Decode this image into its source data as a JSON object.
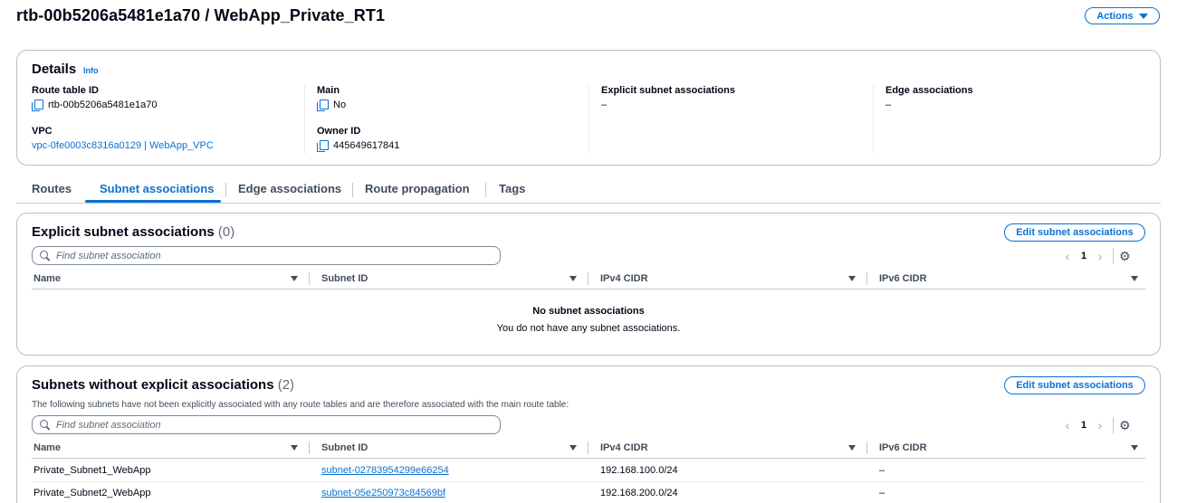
{
  "header": {
    "title": "rtb-00b5206a5481e1a70 / WebApp_Private_RT1",
    "actions_label": "Actions"
  },
  "details": {
    "heading": "Details",
    "info_label": "Info",
    "route_table_id_label": "Route table ID",
    "route_table_id": "rtb-00b5206a5481e1a70",
    "vpc_label": "VPC",
    "vpc_value": "vpc-0fe0003c8316a0129 | WebApp_VPC",
    "main_label": "Main",
    "main_value": "No",
    "owner_id_label": "Owner ID",
    "owner_id": "445649617841",
    "explicit_label": "Explicit subnet associations",
    "explicit_value": "–",
    "edge_label": "Edge associations",
    "edge_value": "–"
  },
  "tabs": [
    {
      "label": "Routes",
      "active": false
    },
    {
      "label": "Subnet associations",
      "active": true
    },
    {
      "label": "Edge associations",
      "active": false
    },
    {
      "label": "Route propagation",
      "active": false
    },
    {
      "label": "Tags",
      "active": false
    }
  ],
  "explicit_section": {
    "title": "Explicit subnet associations",
    "count": "(0)",
    "edit_label": "Edit subnet associations",
    "search_placeholder": "Find subnet association",
    "page": "1",
    "columns": [
      "Name",
      "Subnet ID",
      "IPv4 CIDR",
      "IPv6 CIDR"
    ],
    "empty_title": "No subnet associations",
    "empty_message": "You do not have any subnet associations."
  },
  "implicit_section": {
    "title": "Subnets without explicit associations",
    "count": "(2)",
    "description": "The following subnets have not been explicitly associated with any route tables and are therefore associated with the main route table:",
    "edit_label": "Edit subnet associations",
    "search_placeholder": "Find subnet association",
    "page": "1",
    "columns": [
      "Name",
      "Subnet ID",
      "IPv4 CIDR",
      "IPv6 CIDR"
    ],
    "rows": [
      {
        "name": "Private_Subnet1_WebApp",
        "subnet_id": "subnet-02783954299e66254",
        "ipv4": "192.168.100.0/24",
        "ipv6": "–"
      },
      {
        "name": "Private_Subnet2_WebApp",
        "subnet_id": "subnet-05e250973c84569bf",
        "ipv4": "192.168.200.0/24",
        "ipv6": "–"
      }
    ]
  },
  "colors": {
    "accent": "#0972d3",
    "text": "#000716",
    "border": "#b6bec9"
  }
}
